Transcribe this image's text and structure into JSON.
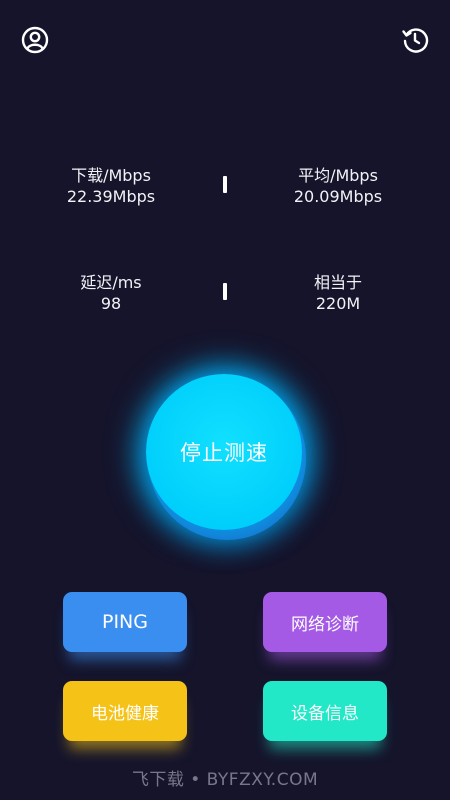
{
  "header": {
    "left_icon": "user-profile-icon",
    "right_icon": "history-icon"
  },
  "stats": {
    "download": {
      "label": "下载/Mbps",
      "value": "22.39Mbps"
    },
    "average": {
      "label": "平均/Mbps",
      "value": "20.09Mbps"
    },
    "latency": {
      "label": "延迟/ms",
      "value": "98"
    },
    "equivalent": {
      "label": "相当于",
      "value": "220M"
    }
  },
  "action": {
    "stop_label": "停止测速"
  },
  "tools": {
    "ping": "PING",
    "network_diagnosis": "网络诊断",
    "battery_health": "电池健康",
    "device_info": "设备信息"
  },
  "colors": {
    "background": "#15142b",
    "ping": "#3a8ef0",
    "network_diagnosis": "#a55ae6",
    "battery_health": "#f5c218",
    "device_info": "#22e8c8",
    "main_button": "#00cffc"
  },
  "watermark": "飞下载 • BYFZXY.COM"
}
